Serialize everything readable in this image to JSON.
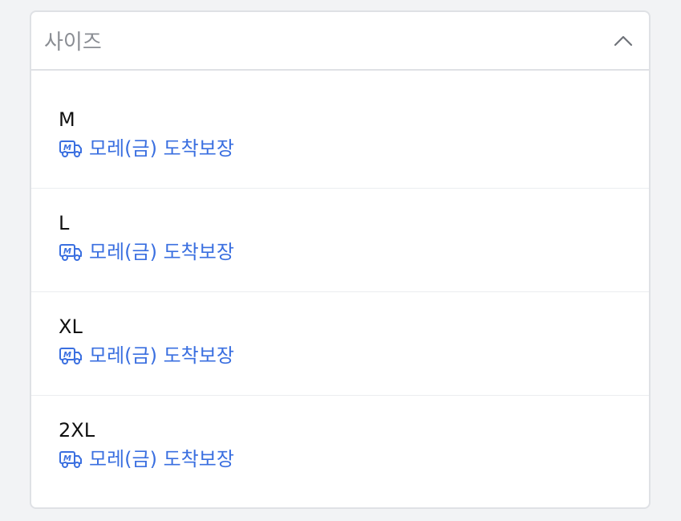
{
  "dropdown": {
    "title": "사이즈",
    "expanded": true,
    "options": [
      {
        "label": "M",
        "delivery": "모레(금) 도착보장"
      },
      {
        "label": "L",
        "delivery": "모레(금) 도착보장"
      },
      {
        "label": "XL",
        "delivery": "모레(금) 도착보장"
      },
      {
        "label": "2XL",
        "delivery": "모레(금) 도착보장"
      }
    ]
  },
  "icons": {
    "toggle": "chevron-up-icon",
    "delivery": "delivery-truck-icon"
  },
  "colors": {
    "accent": "#3a6fe0",
    "border": "#dfe1e5",
    "placeholder": "#8a8d93"
  }
}
